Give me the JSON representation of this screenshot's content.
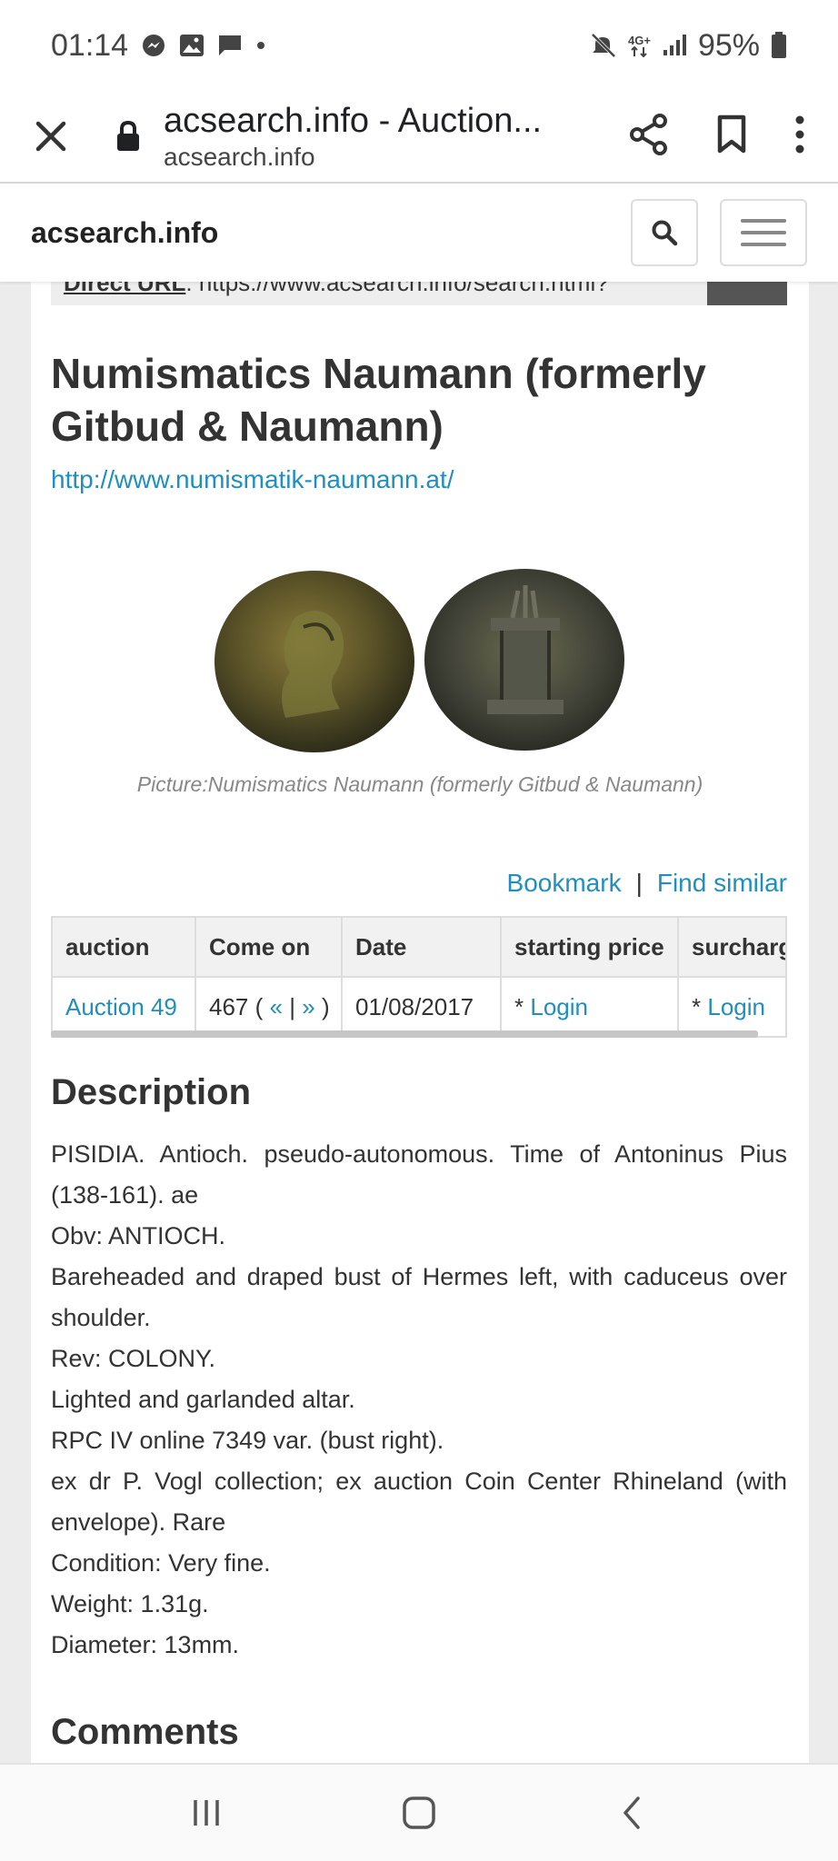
{
  "status_bar": {
    "time": "01:14",
    "network": "4G+",
    "battery": "95%",
    "icons": [
      "messenger-icon",
      "gallery-icon",
      "chat-icon",
      "dot-icon",
      "mute-icon",
      "data-arrows-icon",
      "signal-icon",
      "battery-icon"
    ]
  },
  "browser": {
    "page_title": "acsearch.info - Auction...",
    "domain": "acsearch.info",
    "icons": [
      "close-icon",
      "lock-icon",
      "share-icon",
      "bookmark-icon",
      "more-vert-icon"
    ]
  },
  "site": {
    "brand": "acsearch.info"
  },
  "direct_url": {
    "label": "Direct URL",
    "value": "https://www.acsearch.info/search.html?"
  },
  "lot": {
    "house_name": "Numismatics Naumann (formerly Gitbud & Naumann)",
    "house_url": "http://www.numismatik-naumann.at/",
    "picture_caption": "Picture:Numismatics Naumann (formerly Gitbud & Naumann)"
  },
  "actions": {
    "bookmark": "Bookmark",
    "separator": "|",
    "find_similar": "Find similar"
  },
  "table": {
    "headers": [
      "auction",
      "Come on",
      "Date",
      "starting price",
      "surcharg"
    ],
    "row": {
      "auction": "Auction 49",
      "lot_number": "467",
      "lot_open": "(",
      "prev": "«",
      "pipe": "|",
      "next": "»",
      "lot_close": ")",
      "date": "01/08/2017",
      "start_star": "*",
      "start_login": "Login",
      "surcharge_star": "*",
      "surcharge_login": "Login"
    }
  },
  "description": {
    "heading": "Description",
    "lines": [
      "PISIDIA. Antioch. pseudo-autonomous. Time of Antoninus Pius (138-161). ae",
      "Obv: ANTIOCH.",
      "Bareheaded and draped bust of Hermes left, with caduceus over shoulder.",
      "Rev: COLONY.",
      "Lighted and garlanded altar.",
      "RPC IV online 7349 var. (bust right).",
      "ex dr P. Vogl collection; ex auction Coin Center Rhineland (with envelope). Rare",
      "Condition: Very fine.",
      "Weight: 1.31g.",
      "Diameter: 13mm."
    ]
  },
  "comments": {
    "heading": "Comments"
  },
  "nav_bar": {
    "icons": [
      "recents-icon",
      "home-icon",
      "back-icon"
    ]
  },
  "colors": {
    "link": "#1f8fbf",
    "page_bg": "#ececec",
    "table_header_bg": "#f1f1f1"
  }
}
